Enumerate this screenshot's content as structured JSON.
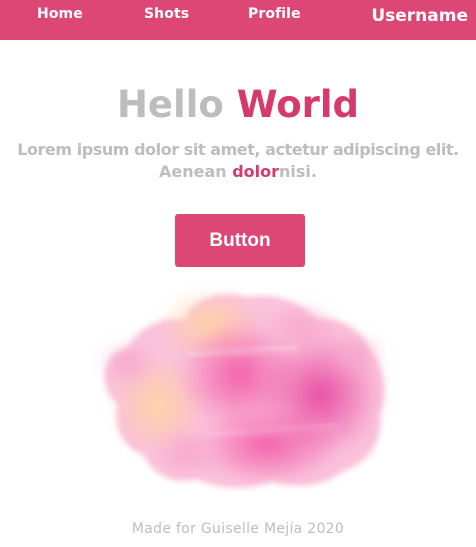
{
  "nav": {
    "home": "Home",
    "shots": "Shots",
    "profile": "Profile",
    "username": "Username"
  },
  "hero": {
    "title_part1": "Hello",
    "title_part2": "World",
    "subtitle_line1": "Lorem ipsum dolor sit amet, actetur adipiscing elit.",
    "subtitle_line2_prefix": "Aenean ",
    "subtitle_line2_accent": "dolor",
    "subtitle_line2_suffix": "nisi."
  },
  "cta": {
    "label": "Button"
  },
  "illustration": {
    "icon": "watercolor-blob-image"
  },
  "footer": {
    "text": "Made for Guiselle Mejía 2020"
  },
  "colors": {
    "brand": "#dc4776",
    "accent_text": "#d63a6c",
    "muted_text": "#bdbdbd",
    "background": "#ffffff"
  }
}
